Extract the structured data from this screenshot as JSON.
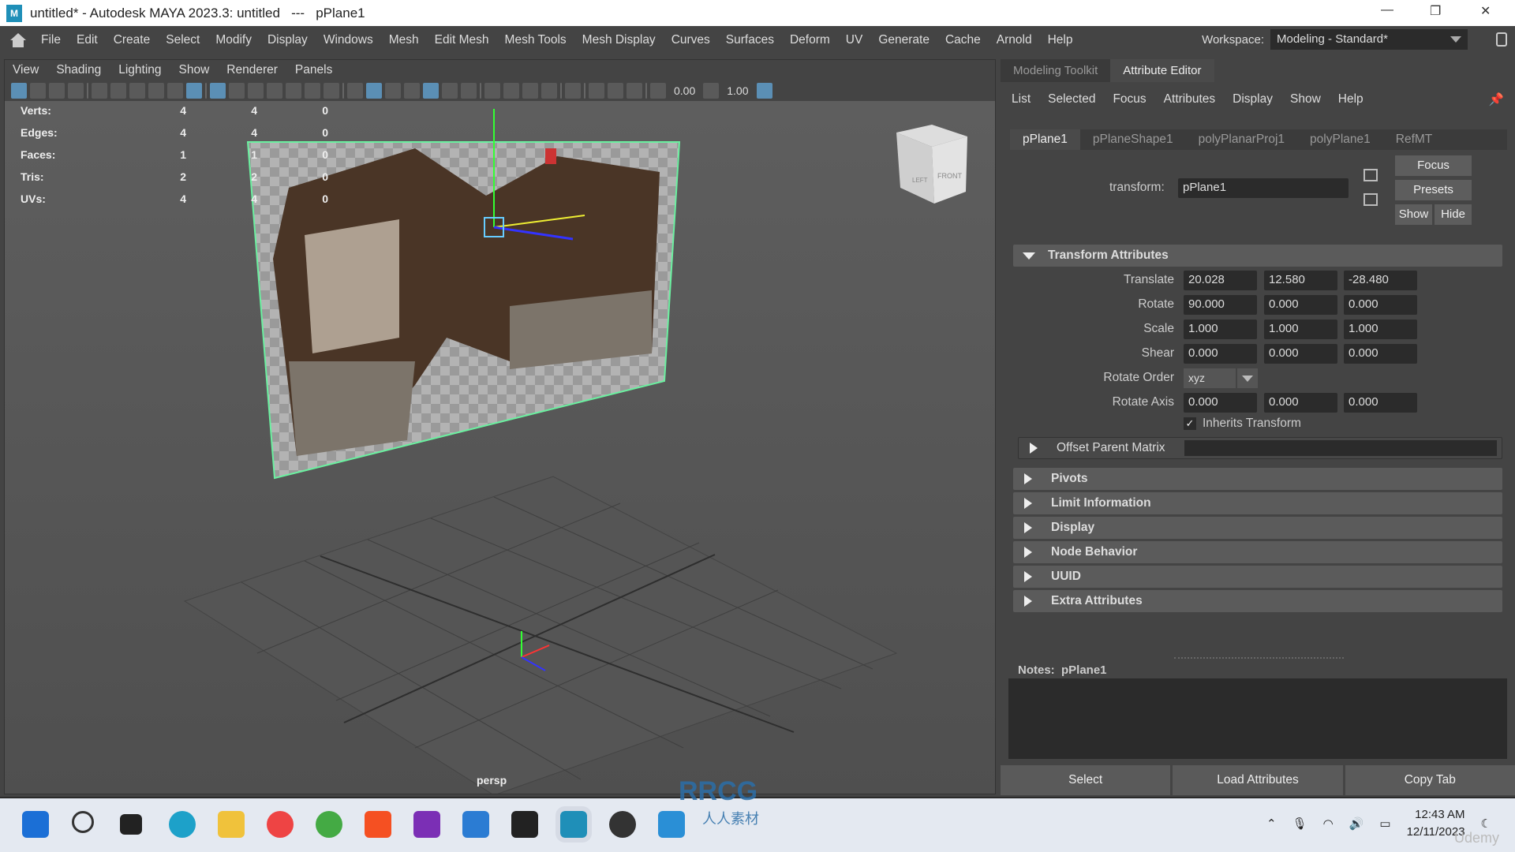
{
  "window": {
    "title": "untitled* - Autodesk MAYA 2023.3: untitled   ---   pPlane1",
    "app_icon": "maya-logo"
  },
  "menubar": {
    "items": [
      "File",
      "Edit",
      "Create",
      "Select",
      "Modify",
      "Display",
      "Windows",
      "Mesh",
      "Edit Mesh",
      "Mesh Tools",
      "Mesh Display",
      "Curves",
      "Surfaces",
      "Deform",
      "UV",
      "Generate",
      "Cache",
      "Arnold",
      "Help"
    ],
    "workspace_label": "Workspace:",
    "workspace_value": "Modeling - Standard*"
  },
  "viewport": {
    "menu": [
      "View",
      "Shading",
      "Lighting",
      "Show",
      "Renderer",
      "Panels"
    ],
    "toolbar_values": {
      "value1": "0.00",
      "value2": "1.00"
    },
    "hud": [
      {
        "label": "Verts:",
        "a": "4",
        "b": "4",
        "c": "0"
      },
      {
        "label": "Edges:",
        "a": "4",
        "b": "4",
        "c": "0"
      },
      {
        "label": "Faces:",
        "a": "1",
        "b": "1",
        "c": "0"
      },
      {
        "label": "Tris:",
        "a": "2",
        "b": "2",
        "c": "0"
      },
      {
        "label": "UVs:",
        "a": "4",
        "b": "4",
        "c": "0"
      }
    ],
    "camera_label": "persp",
    "viewcube": {
      "front": "FRONT",
      "left": "LEFT"
    },
    "selection_color": "#6bf0a0"
  },
  "right_panel": {
    "tabs": [
      "Modeling Toolkit",
      "Attribute Editor"
    ],
    "active_tab": "Attribute Editor",
    "menu": [
      "List",
      "Selected",
      "Focus",
      "Attributes",
      "Display",
      "Show",
      "Help"
    ],
    "node_tabs": [
      "pPlane1",
      "pPlaneShape1",
      "polyPlanarProj1",
      "polyPlane1",
      "RefMT"
    ],
    "transform_label": "transform:",
    "transform_value": "pPlane1",
    "buttons": {
      "focus": "Focus",
      "presets": "Presets",
      "show": "Show",
      "hide": "Hide"
    },
    "transform_section": "Transform Attributes",
    "attributes": [
      {
        "label": "Translate",
        "values": [
          "20.028",
          "12.580",
          "-28.480"
        ]
      },
      {
        "label": "Rotate",
        "values": [
          "90.000",
          "0.000",
          "0.000"
        ]
      },
      {
        "label": "Scale",
        "values": [
          "1.000",
          "1.000",
          "1.000"
        ]
      },
      {
        "label": "Shear",
        "values": [
          "0.000",
          "0.000",
          "0.000"
        ]
      }
    ],
    "rotate_order": {
      "label": "Rotate Order",
      "value": "xyz"
    },
    "rotate_axis": {
      "label": "Rotate Axis",
      "values": [
        "0.000",
        "0.000",
        "0.000"
      ]
    },
    "inherits_transform": {
      "label": "Inherits Transform",
      "checked": true
    },
    "offset_parent_matrix": "Offset Parent Matrix",
    "sections": [
      "Pivots",
      "Limit Information",
      "Display",
      "Node Behavior",
      "UUID",
      "Extra Attributes"
    ],
    "notes_label": "Notes:  pPlane1",
    "bottom_buttons": [
      "Select",
      "Load Attributes",
      "Copy Tab"
    ]
  },
  "taskbar": {
    "apps": [
      "start",
      "search",
      "task-view",
      "edge",
      "file-explorer",
      "chrome",
      "chrome-2",
      "brave",
      "onenote",
      "todo",
      "sticky-notes",
      "maya",
      "davinci-resolve",
      "photos"
    ],
    "time": "12:43 AM",
    "date": "12/11/2023"
  },
  "watermarks": {
    "rrcg": "RRCG",
    "rrcg_sub": "人人素材",
    "udemy": "Udemy"
  }
}
